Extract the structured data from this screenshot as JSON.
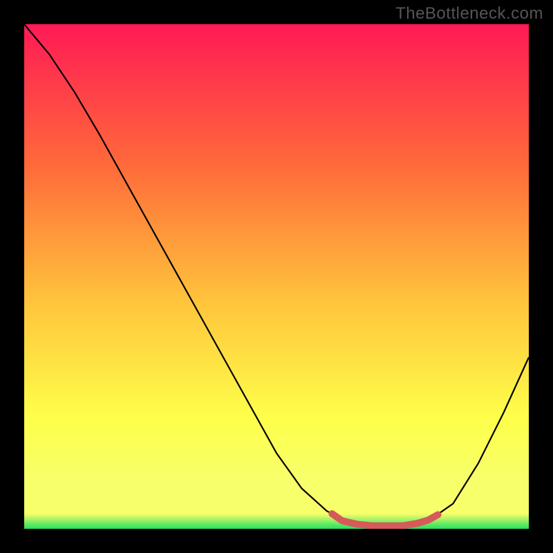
{
  "watermark": "TheBottleneck.com",
  "colors": {
    "bg": "#000000",
    "grad_top": "#ff1a55",
    "grad_mid1": "#ff6a3a",
    "grad_mid2": "#ffc43c",
    "grad_mid3": "#feff4a",
    "grad_bottom_yellow": "#f7ff6a",
    "grad_green": "#23e05f",
    "curve": "#000000",
    "marker": "#d65a59"
  },
  "chart_data": {
    "type": "line",
    "title": "",
    "xlabel": "",
    "ylabel": "",
    "xlim": [
      0,
      100
    ],
    "ylim": [
      0,
      100
    ],
    "series": [
      {
        "name": "bottleneck-curve",
        "points": [
          {
            "x": 0,
            "y": 100
          },
          {
            "x": 5,
            "y": 94
          },
          {
            "x": 10,
            "y": 86.5
          },
          {
            "x": 15,
            "y": 78
          },
          {
            "x": 20,
            "y": 69
          },
          {
            "x": 25,
            "y": 60
          },
          {
            "x": 30,
            "y": 51
          },
          {
            "x": 35,
            "y": 42
          },
          {
            "x": 40,
            "y": 33
          },
          {
            "x": 45,
            "y": 24
          },
          {
            "x": 50,
            "y": 15
          },
          {
            "x": 55,
            "y": 8
          },
          {
            "x": 60,
            "y": 3.5
          },
          {
            "x": 65,
            "y": 1.2
          },
          {
            "x": 70,
            "y": 0.6
          },
          {
            "x": 75,
            "y": 0.6
          },
          {
            "x": 80,
            "y": 1.5
          },
          {
            "x": 85,
            "y": 5
          },
          {
            "x": 90,
            "y": 13
          },
          {
            "x": 95,
            "y": 23
          },
          {
            "x": 100,
            "y": 34
          }
        ]
      },
      {
        "name": "optimal-marker",
        "points": [
          {
            "x": 61,
            "y": 3.0
          },
          {
            "x": 63,
            "y": 1.6
          },
          {
            "x": 66,
            "y": 0.9
          },
          {
            "x": 69,
            "y": 0.6
          },
          {
            "x": 72,
            "y": 0.6
          },
          {
            "x": 75,
            "y": 0.6
          },
          {
            "x": 78,
            "y": 1.1
          },
          {
            "x": 80,
            "y": 1.7
          },
          {
            "x": 82,
            "y": 2.8
          }
        ]
      }
    ]
  }
}
